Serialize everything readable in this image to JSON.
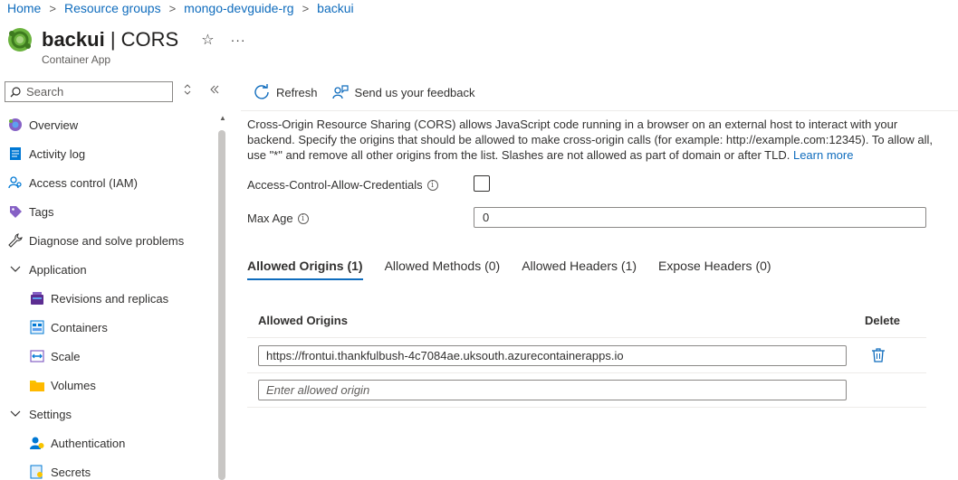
{
  "breadcrumb": {
    "items": [
      "Home",
      "Resource groups",
      "mongo-devguide-rg",
      "backui"
    ],
    "separator": ">"
  },
  "header": {
    "resource_name": "backui",
    "title_separator": " | ",
    "page_name": "CORS",
    "star": "☆",
    "more": "···",
    "subtitle": "Container App"
  },
  "search": {
    "placeholder": "Search"
  },
  "sidebar": {
    "items": [
      {
        "label": "Overview",
        "icon": "overview-icon"
      },
      {
        "label": "Activity log",
        "icon": "activity-log-icon"
      },
      {
        "label": "Access control (IAM)",
        "icon": "access-control-icon"
      },
      {
        "label": "Tags",
        "icon": "tag-icon"
      },
      {
        "label": "Diagnose and solve problems",
        "icon": "wrench-icon"
      },
      {
        "label": "Application",
        "icon": "chevron-down-icon"
      },
      {
        "label": "Revisions and replicas",
        "icon": "revisions-icon"
      },
      {
        "label": "Containers",
        "icon": "containers-icon"
      },
      {
        "label": "Scale",
        "icon": "scale-icon"
      },
      {
        "label": "Volumes",
        "icon": "folder-icon"
      },
      {
        "label": "Settings",
        "icon": "chevron-down-icon"
      },
      {
        "label": "Authentication",
        "icon": "authentication-icon"
      },
      {
        "label": "Secrets",
        "icon": "secrets-icon"
      }
    ]
  },
  "toolbar": {
    "refresh_label": "Refresh",
    "feedback_label": "Send us your feedback"
  },
  "description": {
    "text": "Cross-Origin Resource Sharing (CORS) allows JavaScript code running in a browser on an external host to interact with your backend. Specify the origins that should be allowed to make cross-origin calls (for example: http://example.com:12345). To allow all, use \"*\" and remove all other origins from the list. Slashes are not allowed as part of domain or after TLD.",
    "learn_more": "Learn more"
  },
  "form": {
    "credentials_label": "Access-Control-Allow-Credentials",
    "credentials_checked": false,
    "max_age_label": "Max Age",
    "max_age_value": "0",
    "info_glyph": "i"
  },
  "tabs": [
    {
      "label": "Allowed Origins (1)",
      "active": true
    },
    {
      "label": "Allowed Methods (0)",
      "active": false
    },
    {
      "label": "Allowed Headers (1)",
      "active": false
    },
    {
      "label": "Expose Headers (0)",
      "active": false
    }
  ],
  "grid": {
    "col_origins": "Allowed Origins",
    "col_delete": "Delete",
    "rows": [
      "https://frontui.thankfulbush-4c7084ae.uksouth.azurecontainerapps.io"
    ],
    "new_placeholder": "Enter allowed origin"
  },
  "colors": {
    "accent": "#0f6cbd",
    "text": "#323130",
    "muted": "#605e5c",
    "border": "#8a8886"
  }
}
